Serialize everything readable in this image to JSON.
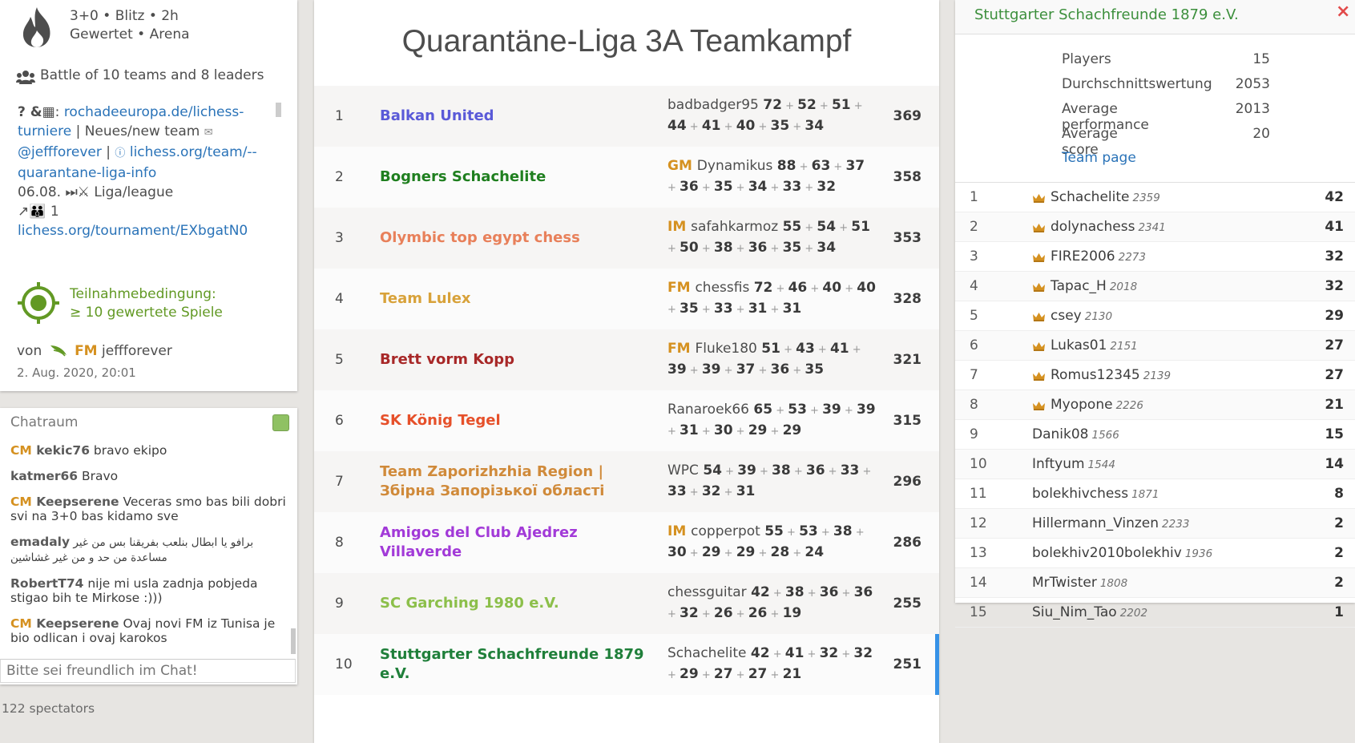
{
  "sidebar": {
    "setup": "3+0 • Blitz • 2h",
    "rated": "Gewertet • Arena",
    "battle": "Battle of 10 teams and 8 leaders",
    "desc_prefix": "? &",
    "desc_link1": "rochadeeuropa.de/lichess-turniere",
    "desc_line2": "| Neues/new team",
    "desc_handle": "@jeffforever",
    "desc_sep": "|",
    "desc_link2": "lichess.org/team/--quarantane-liga-info",
    "desc_date": "06.08. ⏭⚔ Liga/league",
    "desc_num": "↗👪 1",
    "desc_link3": "lichess.org/tournament/EXbgatN0",
    "condition_line1": "Teilnahmebedingung:",
    "condition_line2": "≥ 10 gewertete Spiele",
    "by_label": "von",
    "creator_title": "FM",
    "creator": "jeffforever",
    "created": "2. Aug. 2020, 20:01"
  },
  "chat": {
    "title": "Chatraum",
    "messages": [
      {
        "title": "CM",
        "user": "kekic76",
        "text": "bravo ekipo"
      },
      {
        "title": "",
        "user": "katmer66",
        "text": "Bravo"
      },
      {
        "title": "CM",
        "user": "Keepserene",
        "text": "Veceras smo bas bili dobri svi na 3+0 bas kidamo sve"
      },
      {
        "title": "",
        "user": "emadaly",
        "text": "برافو يا ابطال بنلعب بفريقنا بس من غير مساعدة من حد و من غير غشاشين"
      },
      {
        "title": "",
        "user": "RobertT74",
        "text": "nije mi usla zadnja pobjeda stigao bih te Mirkose :)))"
      },
      {
        "title": "CM",
        "user": "Keepserene",
        "text": "Ovaj novi FM iz Tunisa je bio odlican i ovaj karokos"
      }
    ],
    "placeholder": "Bitte sei freundlich im Chat!",
    "spectators": "122 spectators"
  },
  "main": {
    "title": "Quarantäne-Liga 3A Teamkampf",
    "teams": [
      {
        "rank": "1",
        "name": "Balkan United",
        "color": "#5a5ad8",
        "leader_title": "",
        "leader": "badbadger95",
        "scores": [
          "72",
          "52",
          "51",
          "44",
          "41",
          "40",
          "35",
          "34"
        ],
        "total": "369"
      },
      {
        "rank": "2",
        "name": "Bogners Schachelite",
        "color": "#1f7f1f",
        "leader_title": "GM",
        "leader": "Dynamikus",
        "scores": [
          "88",
          "63",
          "37",
          "36",
          "35",
          "34",
          "33",
          "32"
        ],
        "total": "358"
      },
      {
        "rank": "3",
        "name": "Olymbic top egypt chess",
        "color": "#e8805a",
        "leader_title": "IM",
        "leader": "safahkarmoz",
        "scores": [
          "55",
          "54",
          "51",
          "50",
          "38",
          "36",
          "35",
          "34"
        ],
        "total": "353"
      },
      {
        "rank": "4",
        "name": "Team Lulex",
        "color": "#d8a23a",
        "leader_title": "FM",
        "leader": "chessfis",
        "scores": [
          "72",
          "46",
          "40",
          "40",
          "35",
          "33",
          "31",
          "31"
        ],
        "total": "328"
      },
      {
        "rank": "5",
        "name": "Brett vorm Kopp",
        "color": "#a82828",
        "leader_title": "FM",
        "leader": "Fluke180",
        "scores": [
          "51",
          "43",
          "41",
          "39",
          "39",
          "37",
          "36",
          "35"
        ],
        "total": "321"
      },
      {
        "rank": "6",
        "name": "SK König Tegel",
        "color": "#e6502a",
        "leader_title": "",
        "leader": "Ranaroek66",
        "scores": [
          "65",
          "53",
          "39",
          "39",
          "31",
          "30",
          "29",
          "29"
        ],
        "total": "315"
      },
      {
        "rank": "7",
        "name": "Team Zaporizhzhia Region | Збірна Запорізької області",
        "color": "#d08a3a",
        "leader_title": "",
        "leader": "WPC",
        "scores": [
          "54",
          "39",
          "38",
          "36",
          "33",
          "33",
          "32",
          "31"
        ],
        "total": "296"
      },
      {
        "rank": "8",
        "name": "Amigos del Club Ajedrez Villaverde",
        "color": "#a23ad8",
        "leader_title": "IM",
        "leader": "copperpot",
        "scores": [
          "55",
          "53",
          "38",
          "30",
          "29",
          "29",
          "28",
          "24"
        ],
        "total": "286"
      },
      {
        "rank": "9",
        "name": "SC Garching 1980 e.V.",
        "color": "#8cbf4a",
        "leader_title": "",
        "leader": "chessguitar",
        "scores": [
          "42",
          "38",
          "36",
          "36",
          "32",
          "26",
          "26",
          "19"
        ],
        "total": "255"
      },
      {
        "rank": "10",
        "name": "Stuttgarter Schachfreunde 1879 e.V.",
        "color": "#1f7f3a",
        "leader_title": "",
        "leader": "Schachelite",
        "scores": [
          "42",
          "41",
          "32",
          "32",
          "29",
          "27",
          "27",
          "21"
        ],
        "total": "251"
      }
    ]
  },
  "panel": {
    "team": "Stuttgarter Schachfreunde 1879 e.V.",
    "close_icon": "×",
    "stats": [
      {
        "label": "Players",
        "value": "15"
      },
      {
        "label": "Durchschnittswertung",
        "value": "2053"
      },
      {
        "label": "Average performance",
        "value": "2013"
      },
      {
        "label": "Average score",
        "value": "20"
      }
    ],
    "team_page": "Team page",
    "players": [
      {
        "rank": "1",
        "name": "Schachelite",
        "rating": "2359",
        "score": "42",
        "leader": true
      },
      {
        "rank": "2",
        "name": "dolynachess",
        "rating": "2341",
        "score": "41",
        "leader": true
      },
      {
        "rank": "3",
        "name": "FIRE2006",
        "rating": "2273",
        "score": "32",
        "leader": true
      },
      {
        "rank": "4",
        "name": "Tapac_H",
        "rating": "2018",
        "score": "32",
        "leader": true
      },
      {
        "rank": "5",
        "name": "csey",
        "rating": "2130",
        "score": "29",
        "leader": true
      },
      {
        "rank": "6",
        "name": "Lukas01",
        "rating": "2151",
        "score": "27",
        "leader": true
      },
      {
        "rank": "7",
        "name": "Romus12345",
        "rating": "2139",
        "score": "27",
        "leader": true
      },
      {
        "rank": "8",
        "name": "Myopone",
        "rating": "2226",
        "score": "21",
        "leader": true
      },
      {
        "rank": "9",
        "name": "Danik08",
        "rating": "1566",
        "score": "15",
        "leader": false
      },
      {
        "rank": "10",
        "name": "Inftyum",
        "rating": "1544",
        "score": "14",
        "leader": false
      },
      {
        "rank": "11",
        "name": "bolekhivchess",
        "rating": "1871",
        "score": "8",
        "leader": false
      },
      {
        "rank": "12",
        "name": "Hillermann_Vinzen",
        "rating": "2233",
        "score": "2",
        "leader": false
      },
      {
        "rank": "13",
        "name": "bolekhiv2010bolekhiv",
        "rating": "1936",
        "score": "2",
        "leader": false
      },
      {
        "rank": "14",
        "name": "MrTwister",
        "rating": "1808",
        "score": "2",
        "leader": false
      },
      {
        "rank": "15",
        "name": "Siu_Nim_Tao",
        "rating": "2202",
        "score": "1",
        "leader": false
      }
    ]
  }
}
